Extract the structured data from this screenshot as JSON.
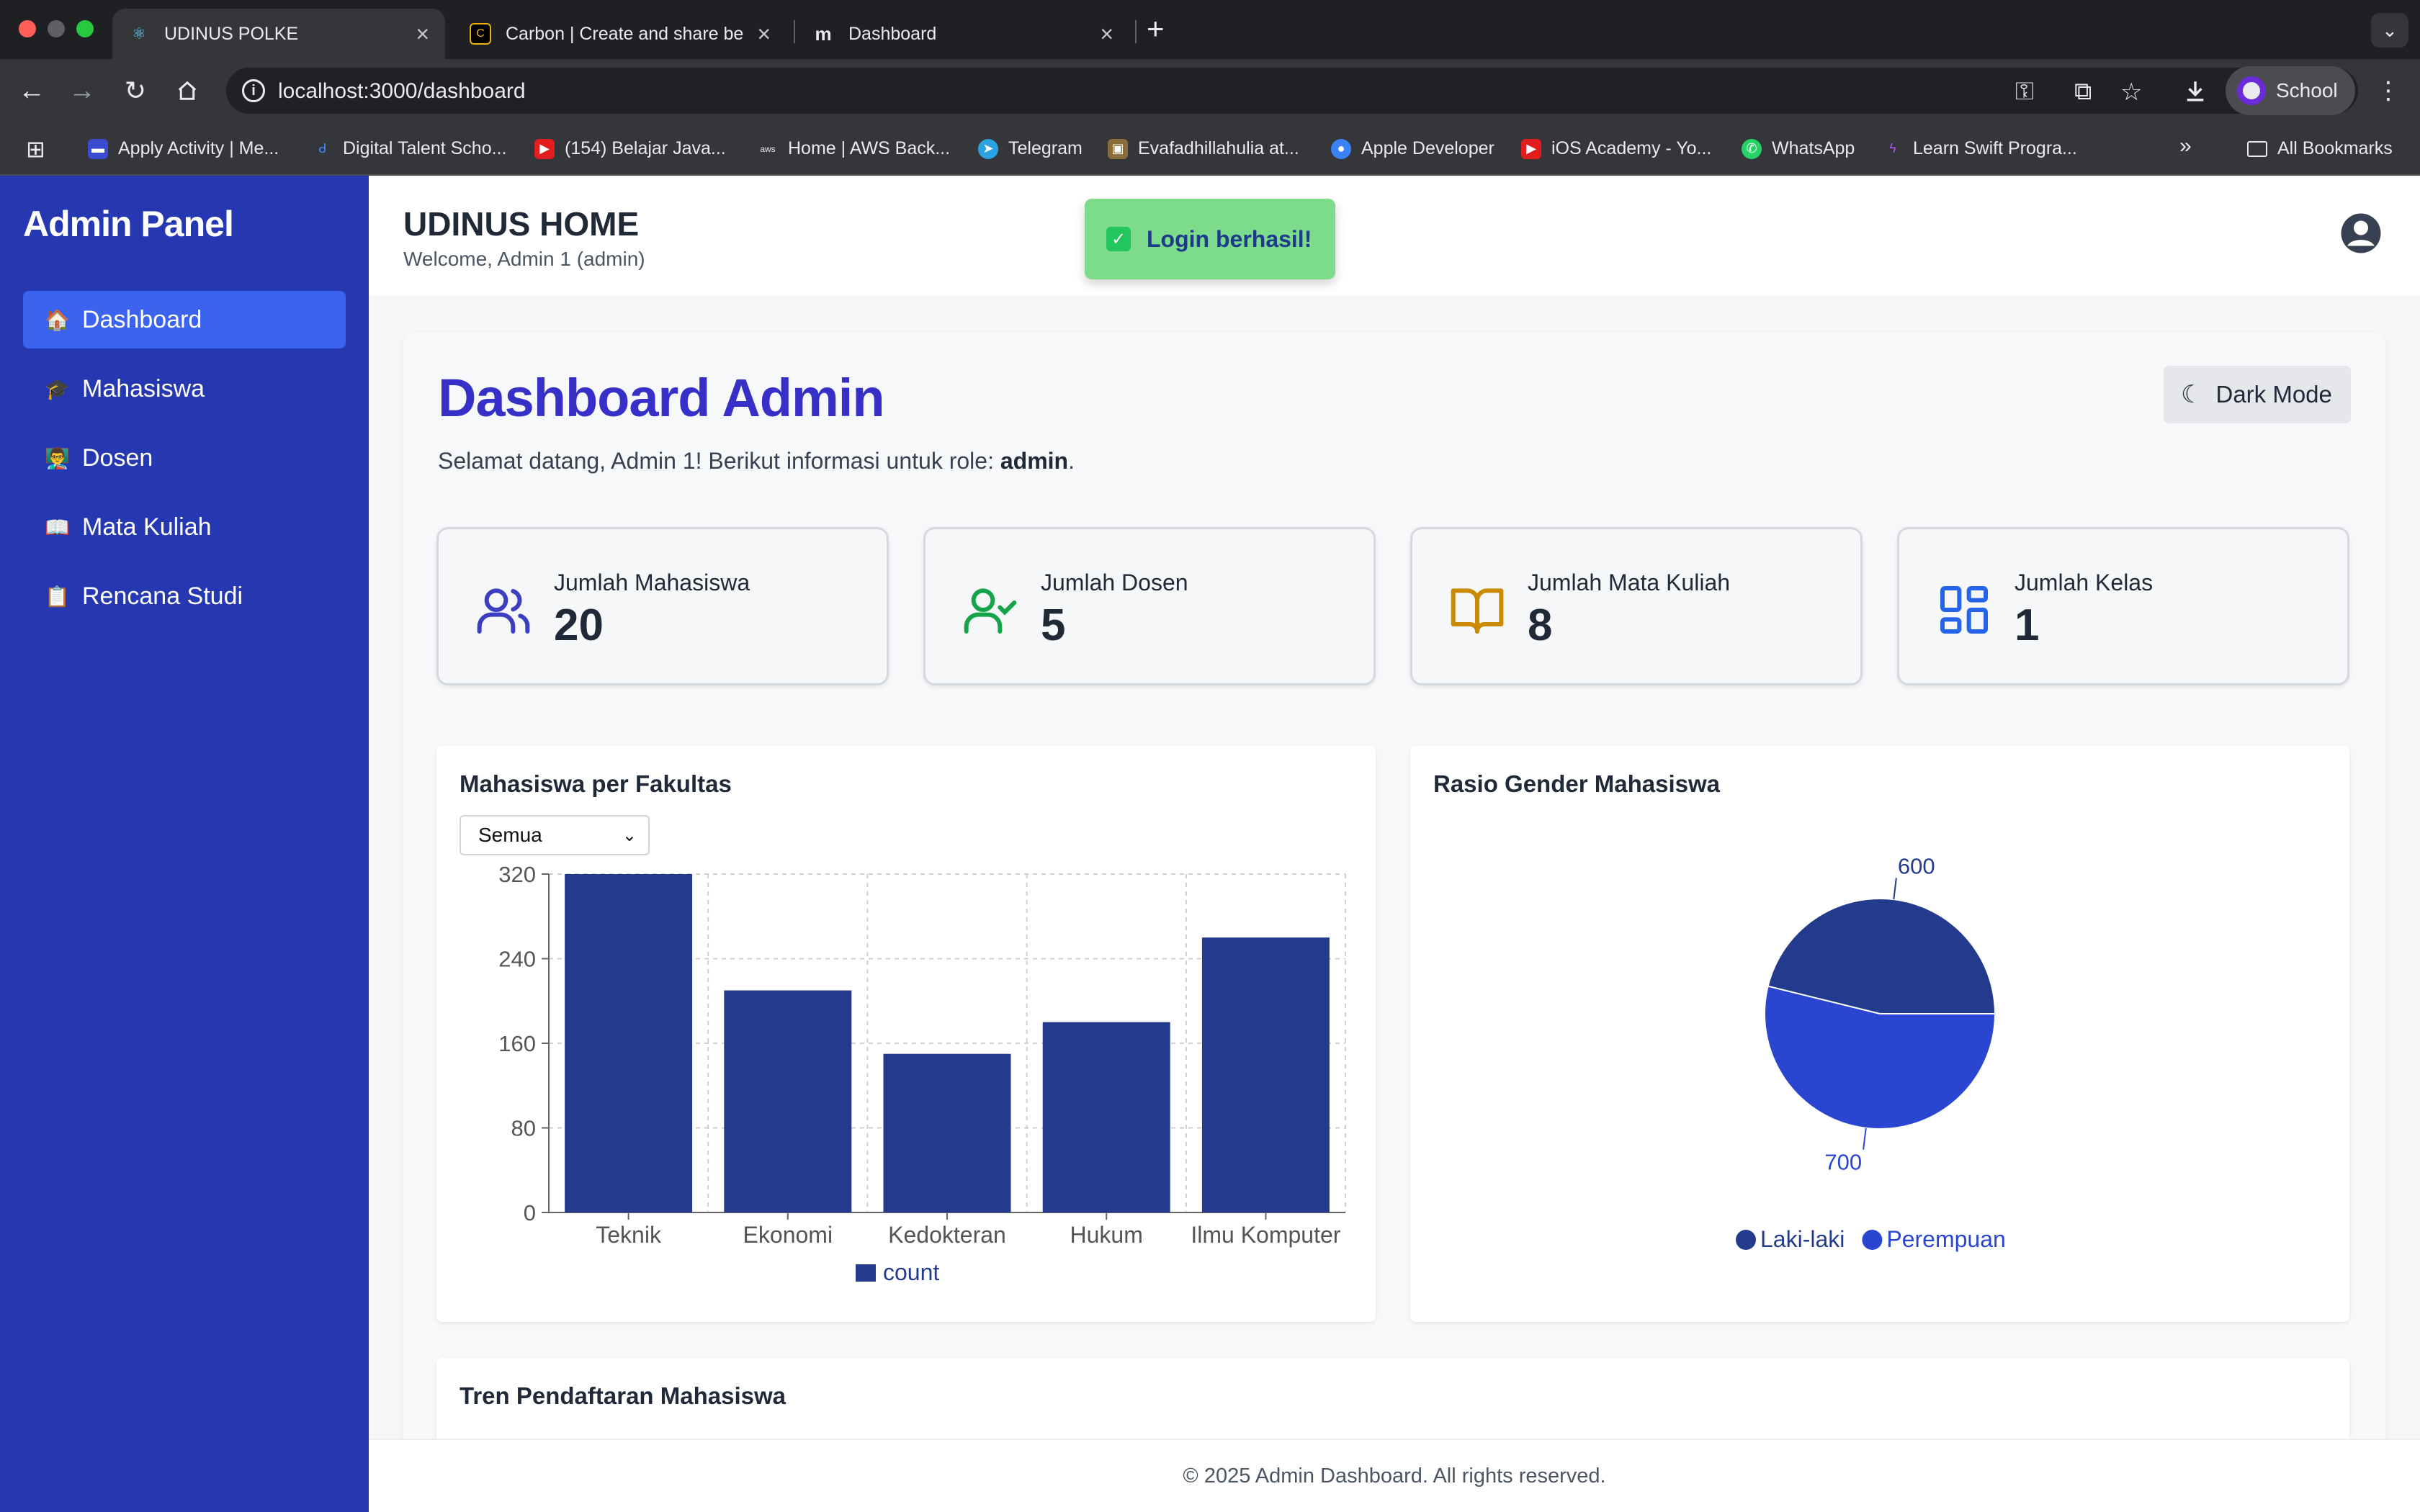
{
  "browser": {
    "tabs": [
      {
        "title": "UDINUS POLKE",
        "active": true
      },
      {
        "title": "Carbon | Create and share be",
        "active": false
      },
      {
        "title": "Dashboard",
        "active": false
      }
    ],
    "url": "localhost:3000/dashboard",
    "profile_name": "School",
    "bookmarks": [
      "Apply Activity | Me...",
      "Digital Talent Scho...",
      "(154) Belajar Java...",
      "Home | AWS Back...",
      "Telegram",
      "Evafadhillahulia at...",
      "Apple Developer",
      "iOS Academy - Yo...",
      "WhatsApp",
      "Learn Swift Progra..."
    ],
    "all_bookmarks_label": "All Bookmarks"
  },
  "sidebar": {
    "brand": "Admin Panel",
    "items": [
      {
        "icon": "🏠",
        "label": "Dashboard",
        "active": true
      },
      {
        "icon": "🎓",
        "label": "Mahasiswa",
        "active": false
      },
      {
        "icon": "👨‍🏫",
        "label": "Dosen",
        "active": false
      },
      {
        "icon": "📖",
        "label": "Mata Kuliah",
        "active": false
      },
      {
        "icon": "📋",
        "label": "Rencana Studi",
        "active": false
      }
    ]
  },
  "header": {
    "title": "UDINUS HOME",
    "welcome": "Welcome, Admin 1 (admin)"
  },
  "toast": {
    "message": "Login berhasil!"
  },
  "dashboard": {
    "title": "Dashboard Admin",
    "greeting_prefix": "Selamat datang, Admin 1! Berikut informasi untuk role: ",
    "role": "admin",
    "greeting_suffix": ".",
    "dark_mode_label": "Dark Mode",
    "stats": [
      {
        "label": "Jumlah Mahasiswa",
        "value": "20",
        "icon": "users-icon",
        "color": "#3b3fbf"
      },
      {
        "label": "Jumlah Dosen",
        "value": "5",
        "icon": "user-check-icon",
        "color": "#16a34a"
      },
      {
        "label": "Jumlah Mata Kuliah",
        "value": "8",
        "icon": "book-icon",
        "color": "#ca8a04"
      },
      {
        "label": "Jumlah Kelas",
        "value": "1",
        "icon": "grid-icon",
        "color": "#2563eb"
      }
    ]
  },
  "faculty_card": {
    "title": "Mahasiswa per Fakultas",
    "filter_value": "Semua"
  },
  "gender_card": {
    "title": "Rasio Gender Mahasiswa"
  },
  "trend_card": {
    "title": "Tren Pendaftaran Mahasiswa"
  },
  "footer": {
    "text": "© 2025 Admin Dashboard. All rights reserved."
  },
  "chart_data": [
    {
      "type": "bar",
      "categories": [
        "Teknik",
        "Ekonomi",
        "Kedokteran",
        "Hukum",
        "Ilmu Komputer"
      ],
      "series": [
        {
          "name": "count",
          "values": [
            320,
            210,
            150,
            180,
            260
          ],
          "color": "#243a8c"
        }
      ],
      "yticks": [
        "0",
        "80",
        "160",
        "240",
        "320"
      ],
      "ylim": [
        0,
        320
      ],
      "grid": true,
      "legend": "bottom"
    },
    {
      "type": "pie",
      "slices": [
        {
          "name": "Laki-laki",
          "value": 600,
          "color": "#243a8c"
        },
        {
          "name": "Perempuan",
          "value": 700,
          "color": "#2a46d1"
        }
      ],
      "legend": "bottom"
    }
  ]
}
